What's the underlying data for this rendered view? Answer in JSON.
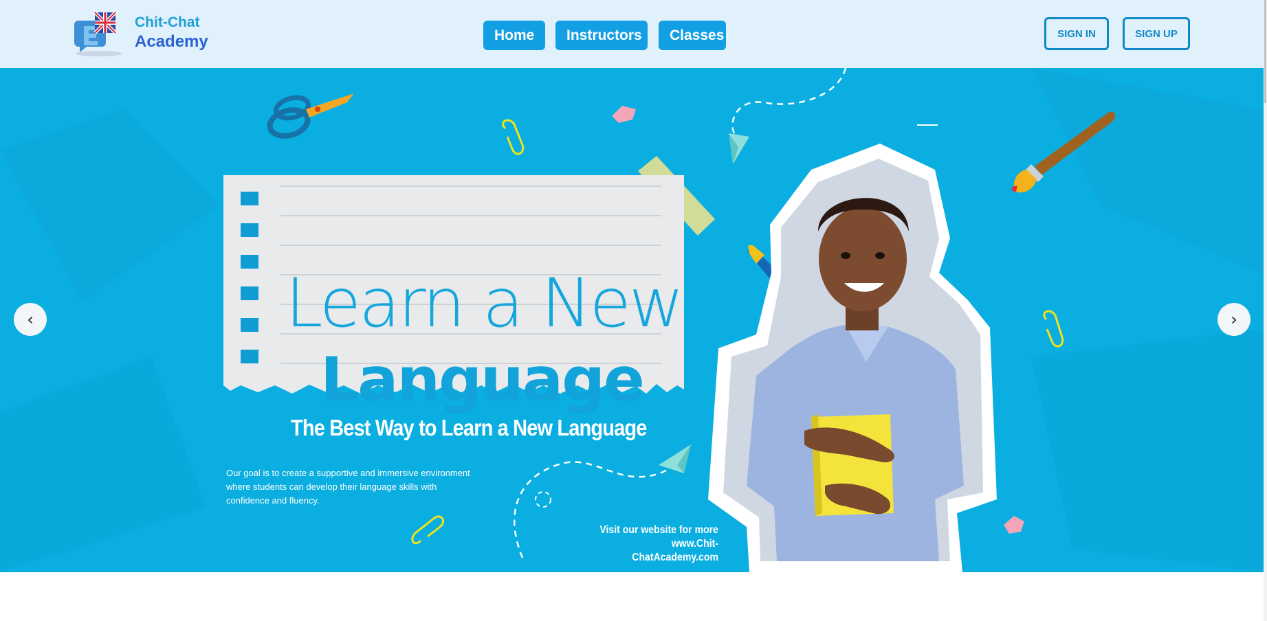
{
  "brand": {
    "top": "Chit-Chat",
    "bottom": "Academy"
  },
  "nav": {
    "items": [
      {
        "label": "Home"
      },
      {
        "label": "Instructors"
      },
      {
        "label": "Classes"
      }
    ]
  },
  "auth": {
    "sign_in": "SIGN IN",
    "sign_up": "SIGN UP"
  },
  "hero": {
    "headline_line1": "Learn a New",
    "headline_line2": "Language",
    "tagline": "The Best Way to Learn a New Language",
    "description": "Our goal is to create a supportive and immersive environment where students can develop their language skills with confidence and fluency.",
    "visit_line1": "Visit our website for more",
    "visit_line2": "www.Chit-ChatAcademy.com"
  },
  "carousel": {
    "prev": "‹",
    "next": "›"
  },
  "colors": {
    "hero_bg": "#0aaee0",
    "nav_bg": "#e0f1fc",
    "nav_button": "#139fe3",
    "auth_border": "#0e88c6",
    "brand_light": "#1ea1d6",
    "brand_dark": "#2a63d4"
  }
}
